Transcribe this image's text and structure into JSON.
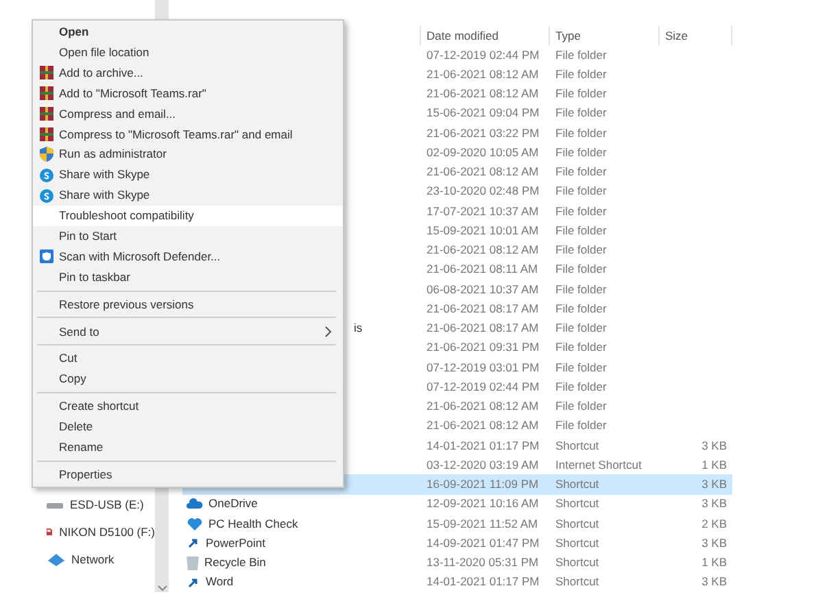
{
  "navigation": [
    {
      "label": "ESD-USB (E:)",
      "kind": "drive"
    },
    {
      "label": "NIKON D5100 (F:)",
      "kind": "sd"
    },
    {
      "label": "Network",
      "kind": "network"
    }
  ],
  "file_list": {
    "columns": [
      "Date modified",
      "Type",
      "Size"
    ],
    "rows": [
      {
        "name": "",
        "date": "07-12-2019 02:44 PM",
        "type": "File folder",
        "size": "",
        "selected": false
      },
      {
        "name": "",
        "date": "21-06-2021 08:12 AM",
        "type": "File folder",
        "size": "",
        "selected": false
      },
      {
        "name": "",
        "date": "21-06-2021 08:12 AM",
        "type": "File folder",
        "size": "",
        "selected": false
      },
      {
        "name": "",
        "date": "15-06-2021 09:04 PM",
        "type": "File folder",
        "size": "",
        "selected": false
      },
      {
        "name": "",
        "date": "21-06-2021 03:22 PM",
        "type": "File folder",
        "size": "",
        "selected": false
      },
      {
        "name": "",
        "date": "02-09-2020 10:05 AM",
        "type": "File folder",
        "size": "",
        "selected": false
      },
      {
        "name": "",
        "date": "21-06-2021 08:12 AM",
        "type": "File folder",
        "size": "",
        "selected": false
      },
      {
        "name": "",
        "date": "23-10-2020 02:48 PM",
        "type": "File folder",
        "size": "",
        "selected": false
      },
      {
        "name": "",
        "date": "17-07-2021 10:37 AM",
        "type": "File folder",
        "size": "",
        "selected": false
      },
      {
        "name": "",
        "date": "15-09-2021 10:01 AM",
        "type": "File folder",
        "size": "",
        "selected": false
      },
      {
        "name": "",
        "date": "21-06-2021 08:12 AM",
        "type": "File folder",
        "size": "",
        "selected": false
      },
      {
        "name": "",
        "date": "21-06-2021 08:11 AM",
        "type": "File folder",
        "size": "",
        "selected": false
      },
      {
        "name": "",
        "date": "06-08-2021 10:37 AM",
        "type": "File folder",
        "size": "",
        "selected": false
      },
      {
        "name": "",
        "date": "21-06-2021 08:17 AM",
        "type": "File folder",
        "size": "",
        "selected": false
      },
      {
        "name": "is",
        "date": "21-06-2021 08:17 AM",
        "type": "File folder",
        "size": "",
        "selected": false
      },
      {
        "name": "",
        "date": "21-06-2021 09:31 PM",
        "type": "File folder",
        "size": "",
        "selected": false
      },
      {
        "name": "",
        "date": "07-12-2019 03:01 PM",
        "type": "File folder",
        "size": "",
        "selected": false
      },
      {
        "name": "",
        "date": "07-12-2019 02:44 PM",
        "type": "File folder",
        "size": "",
        "selected": false
      },
      {
        "name": "",
        "date": "21-06-2021 08:12 AM",
        "type": "File folder",
        "size": "",
        "selected": false
      },
      {
        "name": "",
        "date": "21-06-2021 08:12 AM",
        "type": "File folder",
        "size": "",
        "selected": false
      },
      {
        "name": "",
        "date": "14-01-2021 01:17 PM",
        "type": "Shortcut",
        "size": "3 KB",
        "selected": false
      },
      {
        "name": "",
        "date": "03-12-2020 03:19 AM",
        "type": "Internet Shortcut",
        "size": "1 KB",
        "selected": false
      },
      {
        "name": "",
        "date": "16-09-2021 11:09 PM",
        "type": "Shortcut",
        "size": "3 KB",
        "selected": true
      },
      {
        "name": "OneDrive",
        "kind": "cloud",
        "date": "12-09-2021 10:16 AM",
        "type": "Shortcut",
        "size": "3 KB",
        "selected": false
      },
      {
        "name": "PC Health Check",
        "kind": "heart",
        "date": "15-09-2021 11:52 AM",
        "type": "Shortcut",
        "size": "2 KB",
        "selected": false
      },
      {
        "name": "PowerPoint",
        "kind": "shortcut",
        "date": "14-09-2021 01:47 PM",
        "type": "Shortcut",
        "size": "3 KB",
        "selected": false
      },
      {
        "name": "Recycle Bin",
        "kind": "bin",
        "date": "13-11-2020 05:31 PM",
        "type": "Shortcut",
        "size": "1 KB",
        "selected": false
      },
      {
        "name": "Word",
        "kind": "shortcut",
        "date": "14-01-2021 01:17 PM",
        "type": "Shortcut",
        "size": "3 KB",
        "selected": false
      }
    ]
  },
  "context_menu": [
    {
      "kind": "default",
      "label": "Open",
      "selected": false
    },
    {
      "kind": "item",
      "label": "Open file location",
      "selected": false
    },
    {
      "kind": "archive",
      "label": "Add to archive...",
      "selected": false
    },
    {
      "kind": "archive",
      "label": "Add to \"Microsoft Teams.rar\"",
      "selected": false
    },
    {
      "kind": "archive",
      "label": "Compress and email...",
      "selected": false
    },
    {
      "kind": "archive",
      "label": "Compress to \"Microsoft Teams.rar\" and email",
      "selected": false
    },
    {
      "kind": "shield",
      "label": "Run as administrator",
      "selected": false
    },
    {
      "kind": "skype",
      "label": "Share with Skype",
      "selected": false
    },
    {
      "kind": "skype",
      "label": "Share with Skype",
      "selected": false
    },
    {
      "kind": "item",
      "label": "Troubleshoot compatibility",
      "selected": true
    },
    {
      "kind": "item",
      "label": "Pin to Start",
      "selected": false
    },
    {
      "kind": "defender",
      "label": "Scan with Microsoft Defender...",
      "selected": false
    },
    {
      "kind": "item",
      "label": "Pin to taskbar",
      "selected": false
    },
    {
      "kind": "separator"
    },
    {
      "kind": "item",
      "label": "Restore previous versions",
      "selected": false
    },
    {
      "kind": "separator"
    },
    {
      "kind": "submenu",
      "label": "Send to",
      "selected": false
    },
    {
      "kind": "separator"
    },
    {
      "kind": "item",
      "label": "Cut",
      "selected": false
    },
    {
      "kind": "item",
      "label": "Copy",
      "selected": false
    },
    {
      "kind": "separator"
    },
    {
      "kind": "item",
      "label": "Create shortcut",
      "selected": false
    },
    {
      "kind": "item",
      "label": "Delete",
      "selected": false
    },
    {
      "kind": "item",
      "label": "Rename",
      "selected": false
    },
    {
      "kind": "separator"
    },
    {
      "kind": "item",
      "label": "Properties",
      "selected": false
    }
  ]
}
